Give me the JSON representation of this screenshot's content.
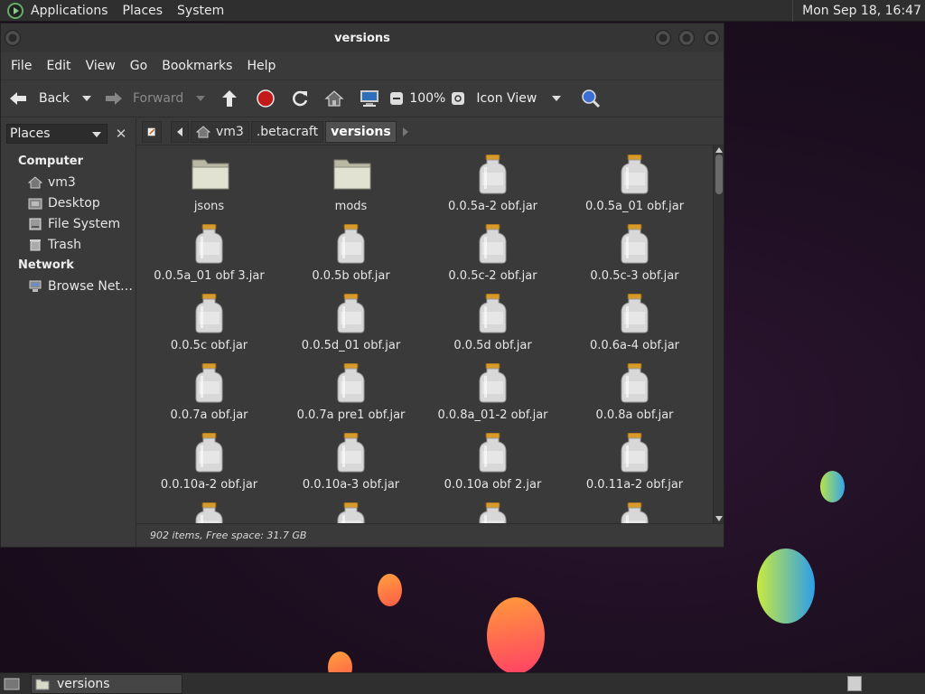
{
  "top_panel": {
    "menus": [
      "Applications",
      "Places",
      "System"
    ],
    "clock": "Mon Sep 18, 16:47"
  },
  "window": {
    "title": "versions",
    "menubar": [
      "File",
      "Edit",
      "View",
      "Go",
      "Bookmarks",
      "Help"
    ],
    "toolbar": {
      "back": "Back",
      "forward": "Forward",
      "zoom": "100%",
      "view_mode": "Icon View"
    },
    "sidebar": {
      "selector": "Places",
      "groups": [
        {
          "title": "Computer",
          "items": [
            "vm3",
            "Desktop",
            "File System",
            "Trash"
          ]
        },
        {
          "title": "Network",
          "items": [
            "Browse Net…"
          ]
        }
      ]
    },
    "path": [
      "vm3",
      ".betacraft",
      "versions"
    ],
    "files": [
      {
        "name": "jsons",
        "type": "folder"
      },
      {
        "name": "mods",
        "type": "folder"
      },
      {
        "name": "0.0.5a-2 obf.jar",
        "type": "jar"
      },
      {
        "name": "0.0.5a_01 obf.jar",
        "type": "jar"
      },
      {
        "name": "0.0.5a_01 obf 3.jar",
        "type": "jar"
      },
      {
        "name": "0.0.5b obf.jar",
        "type": "jar"
      },
      {
        "name": "0.0.5c-2 obf.jar",
        "type": "jar"
      },
      {
        "name": "0.0.5c-3 obf.jar",
        "type": "jar"
      },
      {
        "name": "0.0.5c obf.jar",
        "type": "jar"
      },
      {
        "name": "0.0.5d_01 obf.jar",
        "type": "jar"
      },
      {
        "name": "0.0.5d obf.jar",
        "type": "jar"
      },
      {
        "name": "0.0.6a-4 obf.jar",
        "type": "jar"
      },
      {
        "name": "0.0.7a obf.jar",
        "type": "jar"
      },
      {
        "name": "0.0.7a pre1 obf.jar",
        "type": "jar"
      },
      {
        "name": "0.0.8a_01-2 obf.jar",
        "type": "jar"
      },
      {
        "name": "0.0.8a obf.jar",
        "type": "jar"
      },
      {
        "name": "0.0.10a-2 obf.jar",
        "type": "jar"
      },
      {
        "name": "0.0.10a-3 obf.jar",
        "type": "jar"
      },
      {
        "name": "0.0.10a obf 2.jar",
        "type": "jar"
      },
      {
        "name": "0.0.11a-2 obf.jar",
        "type": "jar"
      },
      {
        "name": "",
        "type": "jar"
      },
      {
        "name": "",
        "type": "jar"
      },
      {
        "name": "",
        "type": "jar"
      },
      {
        "name": "",
        "type": "jar"
      }
    ],
    "status": "902 items, Free space: 31.7 GB"
  },
  "taskbar": {
    "task": "versions"
  }
}
